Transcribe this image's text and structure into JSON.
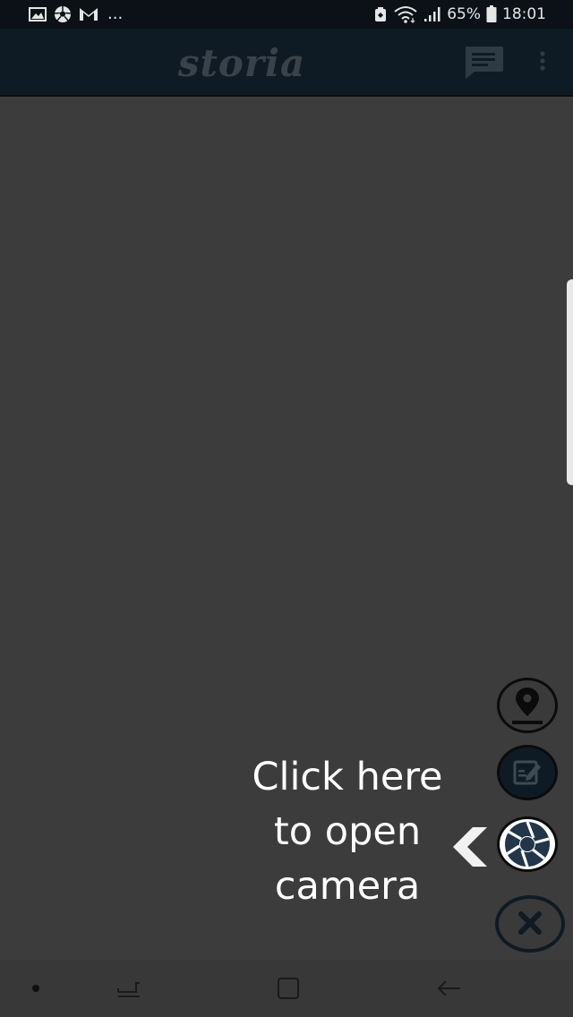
{
  "status_bar": {
    "overflow_indicator": "...",
    "battery_percent": "65%",
    "time": "18:01",
    "icons": [
      "gallery-icon",
      "soccer-ball-icon",
      "gmail-icon",
      "battery-saver-icon",
      "wifi-icon",
      "signal-icon",
      "battery-icon"
    ]
  },
  "app_bar": {
    "logo_text": "storia",
    "icons": [
      "chat-icon",
      "more-vert-icon"
    ]
  },
  "fabs": {
    "location_icon": "location-pin-icon",
    "note_icon": "edit-note-icon",
    "camera_icon": "camera-shutter-icon",
    "close_icon": "close-icon"
  },
  "overlay_hint": {
    "line1": "Click here",
    "line2": "to open",
    "line3": "camera",
    "arrow_icon": "chevron-left-icon"
  },
  "nav_bar": {
    "icons": [
      "dot-icon",
      "recent-apps-icon",
      "home-icon",
      "back-icon"
    ]
  },
  "colors": {
    "background": "#3c3c3c",
    "status_bar": "#0b1117",
    "app_bar": "#0f1b24",
    "camera_shutter": "#22364a",
    "text": "#ffffff"
  }
}
